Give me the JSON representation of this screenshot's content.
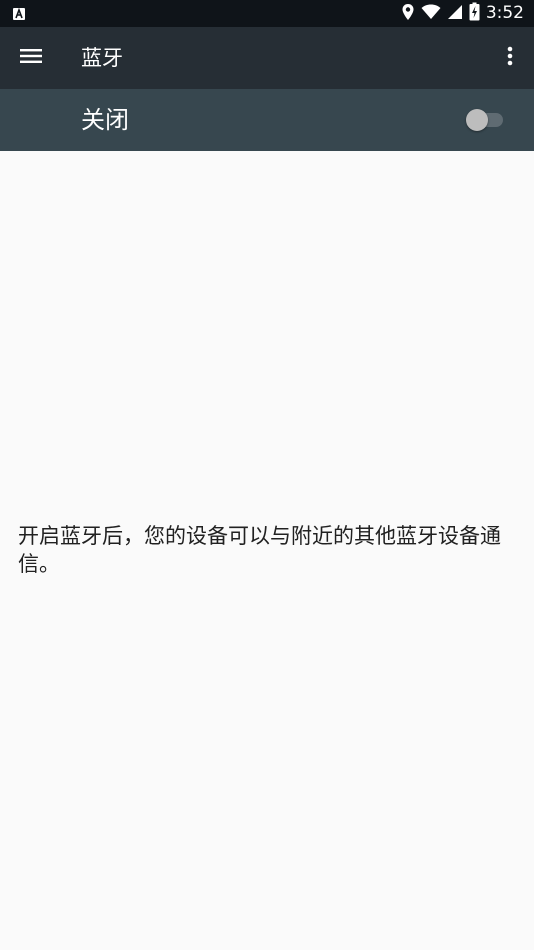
{
  "status_bar": {
    "time": "3:52",
    "icons": [
      "notification-a-icon",
      "location-icon",
      "wifi-icon",
      "signal-icon",
      "battery-charging-icon"
    ]
  },
  "toolbar": {
    "title": "蓝牙",
    "menu_icon": "menu-icon",
    "more_icon": "more-vert-icon"
  },
  "switch_bar": {
    "label": "关闭",
    "enabled": false
  },
  "main": {
    "info_text": "开启蓝牙后，您的设备可以与附近的其他蓝牙设备通信。"
  },
  "colors": {
    "status_bar_bg": "#0f1419",
    "toolbar_bg": "#262e35",
    "switch_bar_bg": "#37474f",
    "content_bg": "#fafafa",
    "text_primary": "#212121"
  }
}
